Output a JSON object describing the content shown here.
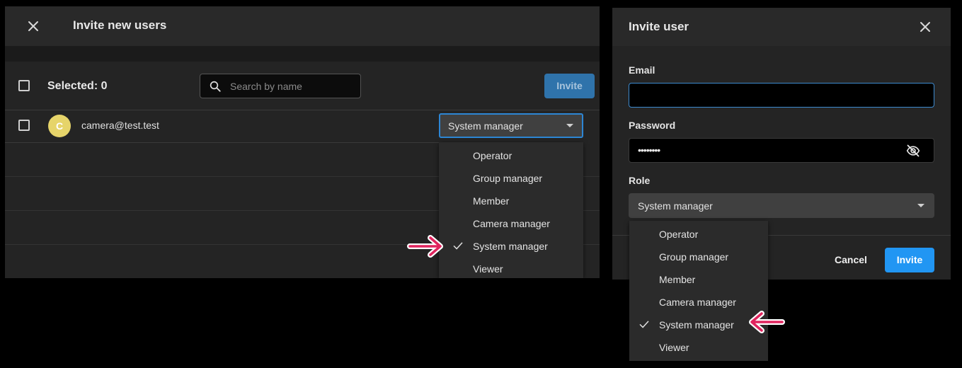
{
  "left_dialog": {
    "title": "Invite new users",
    "selected_label": "Selected: 0",
    "search": {
      "placeholder": "Search by name",
      "value": ""
    },
    "invite_button": "Invite",
    "rows": [
      {
        "avatar_letter": "C",
        "email": "camera@test.test",
        "role": "System manager"
      }
    ],
    "role_options": [
      {
        "label": "Operator",
        "selected": false
      },
      {
        "label": "Group manager",
        "selected": false
      },
      {
        "label": "Member",
        "selected": false
      },
      {
        "label": "Camera manager",
        "selected": false
      },
      {
        "label": "System manager",
        "selected": true
      },
      {
        "label": "Viewer",
        "selected": false
      }
    ]
  },
  "right_dialog": {
    "title": "Invite user",
    "email_label": "Email",
    "email_value": "",
    "password_label": "Password",
    "password_masked": "••••••••",
    "role_label": "Role",
    "role_value": "System manager",
    "cancel_button": "Cancel",
    "invite_button": "Invite",
    "role_options": [
      {
        "label": "Operator",
        "selected": false
      },
      {
        "label": "Group manager",
        "selected": false
      },
      {
        "label": "Member",
        "selected": false
      },
      {
        "label": "Camera manager",
        "selected": false
      },
      {
        "label": "System manager",
        "selected": true
      },
      {
        "label": "Viewer",
        "selected": false
      }
    ]
  },
  "colors": {
    "accent": "#2196f3",
    "avatar": "#e6d46a",
    "annotation_arrow": "#e0245e"
  },
  "icons": [
    "close-icon",
    "search-icon",
    "checkmark-icon",
    "eye-off-icon",
    "chevron-down-icon",
    "arrow-annotation-icon"
  ]
}
